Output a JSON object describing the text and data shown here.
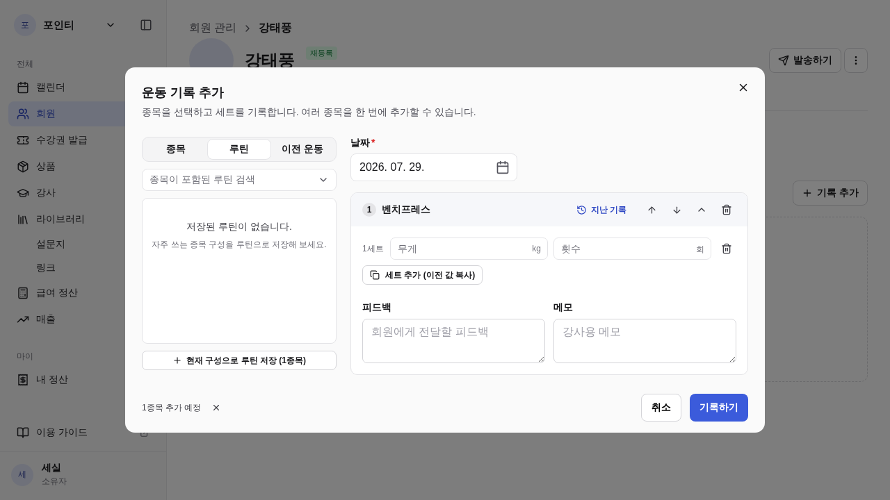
{
  "sidebar": {
    "workspace": {
      "avatar": "포",
      "name": "포인티"
    },
    "sections": [
      {
        "label": "전체",
        "items": [
          {
            "label": "캘린더",
            "selected": false
          },
          {
            "label": "회원",
            "selected": true
          },
          {
            "label": "수강권 발급",
            "selected": false
          },
          {
            "label": "상품",
            "selected": false
          },
          {
            "label": "강사",
            "selected": false
          },
          {
            "label": "라이브러리",
            "selected": false,
            "children": [
              {
                "label": "설문지",
                "selected": false
              },
              {
                "label": "링크",
                "selected": false
              }
            ]
          },
          {
            "label": "급여 정산",
            "selected": false
          },
          {
            "label": "매출",
            "selected": false
          }
        ]
      },
      {
        "label": "마이",
        "items": [
          {
            "label": "내 정산",
            "selected": false
          }
        ]
      }
    ],
    "guide": "이용 가이드",
    "user": {
      "avatar": "세",
      "name": "세실",
      "role": "소유자"
    }
  },
  "main": {
    "breadcrumb": [
      "회원 관리",
      "강태풍"
    ],
    "member_name": "강태풍",
    "badge": "재등록",
    "send_button": "발송하기",
    "add_record_button": "기록 추가"
  },
  "dialog": {
    "title": "운동 기록 추가",
    "description": "종목을 선택하고 세트를 기록합니다. 여러 종목을 한 번에 추가할 수 있습니다.",
    "tabs": [
      {
        "label": "종목",
        "selected": false
      },
      {
        "label": "루틴",
        "selected": true
      },
      {
        "label": "이전 운동",
        "selected": false
      }
    ],
    "search": {
      "placeholder": "종목이 포함된 루틴 검색"
    },
    "empty": {
      "title": "저장된 루틴이 없습니다.",
      "hint": "자주 쓰는 종목 구성을 루틴으로 저장해 보세요."
    },
    "save_routine_button": "현재 구성으로 루틴 저장 (1종목)",
    "date": {
      "label": "날짜",
      "required": "*",
      "value": "2026. 07. 29."
    },
    "exercises": [
      {
        "number": "1",
        "name": "벤치프레스",
        "history_button": "지난 기록",
        "expanded": true,
        "sets": [
          {
            "label": "1세트",
            "weight": {
              "placeholder": "무게",
              "unit": "kg"
            },
            "reps": {
              "placeholder": "횟수",
              "unit": "회"
            }
          }
        ],
        "add_set_button": "세트 추가 (이전 값 복사)",
        "feedback": {
          "label": "피드백",
          "placeholder": "회원에게 전달할 피드백"
        },
        "memo": {
          "label": "메모",
          "placeholder": "강사용 메모"
        }
      }
    ],
    "pending": "1종목 추가 예정",
    "cancel_button": "취소",
    "submit_button": "기록하기"
  }
}
